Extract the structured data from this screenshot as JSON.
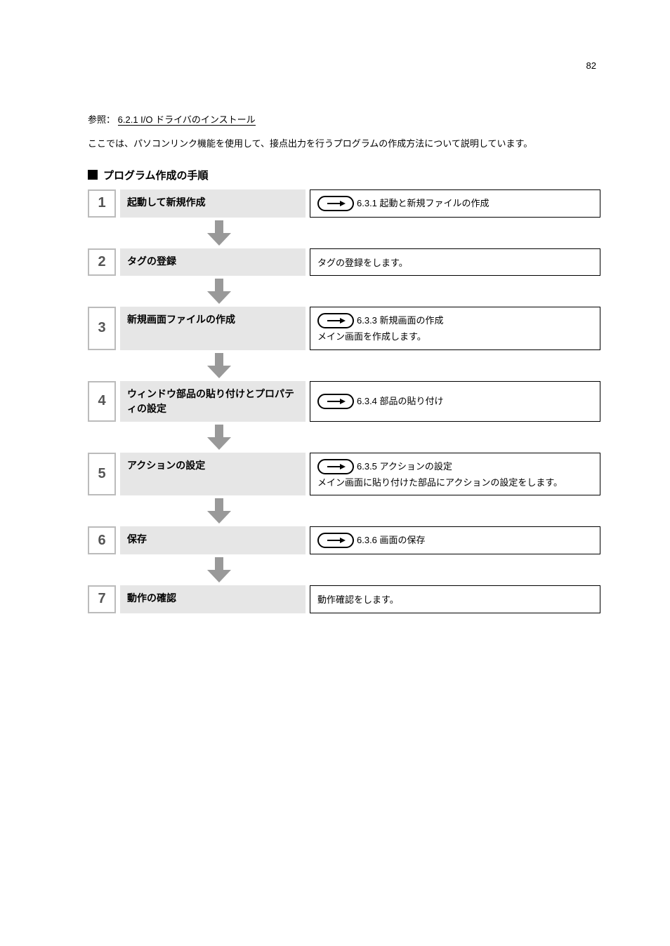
{
  "page_number": "82",
  "reference_line_prefix": "参照：",
  "reference_link": "6.2.1  I/O ドライバのインストール",
  "intro_text": "ここでは、パソコンリンク機能を使用して、接点出力を行うプログラムの作成方法について説明しています。",
  "section_title": "プログラム作成の手順",
  "steps": [
    {
      "num": "1",
      "title": "起動して新規作成",
      "details": [
        {
          "ref": "6.3.1  起動と新規ファイルの作成"
        }
      ]
    },
    {
      "num": "2",
      "title": "タグの登録",
      "details": [
        {
          "text": "タグの登録をします。"
        }
      ]
    },
    {
      "num": "3",
      "title": "新規画面ファイルの作成",
      "details": [
        {
          "ref": "6.3.3  新規画面の作成"
        },
        {
          "text": "メイン画面を作成します。"
        }
      ]
    },
    {
      "num": "4",
      "title": "ウィンドウ部品の貼り付けとプロパティの設定",
      "details": [
        {
          "ref": "6.3.4  部品の貼り付け"
        }
      ]
    },
    {
      "num": "5",
      "title": "アクションの設定",
      "details": [
        {
          "ref": "6.3.5  アクションの設定"
        },
        {
          "text": "メイン画面に貼り付けた部品にアクションの設定をします。"
        }
      ]
    },
    {
      "num": "6",
      "title": "保存",
      "details": [
        {
          "ref": "6.3.6  画面の保存"
        }
      ]
    },
    {
      "num": "7",
      "title": "動作の確認",
      "details": [
        {
          "text": "動作確認をします。"
        }
      ]
    }
  ]
}
